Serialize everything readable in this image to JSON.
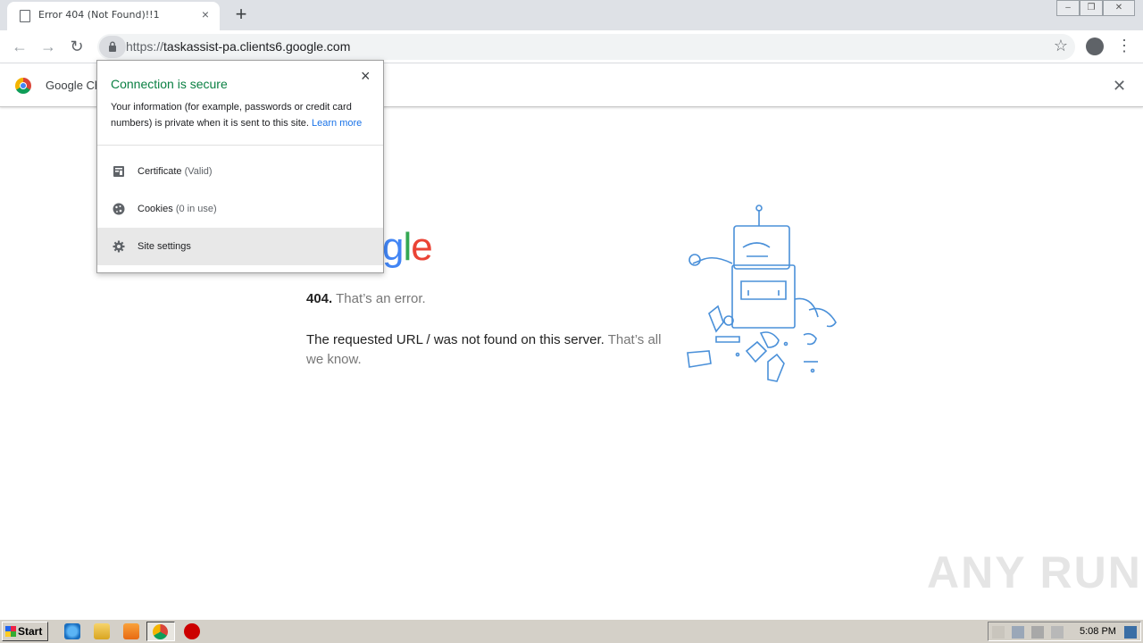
{
  "tab": {
    "title": "Error 404 (Not Found)!!1",
    "close": "×",
    "new_tab": "+"
  },
  "window_controls": [
    "–",
    "❐",
    "✕"
  ],
  "toolbar": {
    "back": "←",
    "forward": "→",
    "reload": "↻",
    "url_scheme": "https://",
    "url_host": "taskassist-pa.clients6.google.com",
    "star": "☆",
    "menu": "⋮"
  },
  "infobar": {
    "text": "Google Ch",
    "close": "✕"
  },
  "page": {
    "logo": {
      "g": "g",
      "l": "l",
      "e": "e"
    },
    "error_code": "404.",
    "error_text": "That’s an error.",
    "message": "The requested URL / was not found on this server.",
    "message_muted": "That’s all we know."
  },
  "popup": {
    "title": "Connection is secure",
    "close": "×",
    "body": "Your information (for example, passwords or credit card numbers) is private when it is sent to this site.",
    "learn_more": "Learn more",
    "rows": [
      {
        "label": "Certificate",
        "sub": "(Valid)",
        "icon": "certificate-icon"
      },
      {
        "label": "Cookies",
        "sub": "(0 in use)",
        "icon": "cookie-icon"
      },
      {
        "label": "Site settings",
        "sub": "",
        "icon": "gear-icon"
      }
    ]
  },
  "watermark": "ANY RUN",
  "taskbar": {
    "start_label": "Start",
    "clock": "5:08 PM"
  },
  "colors": {
    "secure_green": "#0b8043",
    "link_blue": "#1a73e8",
    "google_blue": "#4285f4",
    "google_green": "#34a853",
    "google_red": "#ea4335"
  }
}
